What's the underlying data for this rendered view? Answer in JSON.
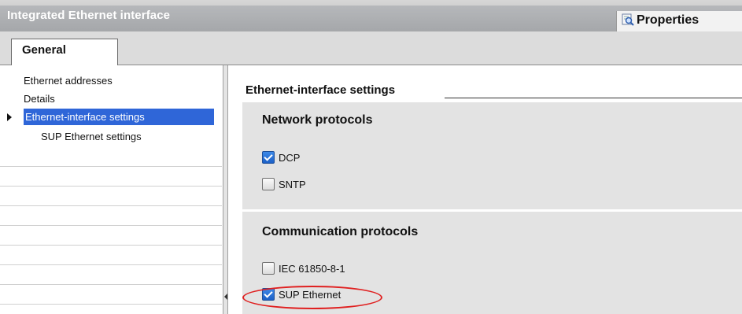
{
  "window": {
    "title": "Integrated Ethernet interface",
    "properties_tab": "Properties"
  },
  "tabs": [
    {
      "label": "General",
      "selected": true
    }
  ],
  "sidebar": {
    "items": [
      {
        "label": "Ethernet addresses",
        "selected": false,
        "indent": 0
      },
      {
        "label": "Details",
        "selected": false,
        "indent": 0
      },
      {
        "label": "Ethernet-interface settings",
        "selected": true,
        "indent": 0
      },
      {
        "label": "SUP Ethernet settings",
        "selected": false,
        "indent": 1
      }
    ]
  },
  "content": {
    "section_title": "Ethernet-interface settings",
    "network_protocols": {
      "title": "Network protocols",
      "options": [
        {
          "label": "DCP",
          "checked": true
        },
        {
          "label": "SNTP",
          "checked": false
        }
      ]
    },
    "communication_protocols": {
      "title": "Communication protocols",
      "options": [
        {
          "label": "IEC 61850-8-1",
          "checked": false
        },
        {
          "label": "SUP Ethernet",
          "checked": true
        }
      ]
    }
  },
  "colors": {
    "selection": "#2f66d8",
    "highlight_annotation": "#e02020",
    "group_background": "#e3e3e3"
  }
}
